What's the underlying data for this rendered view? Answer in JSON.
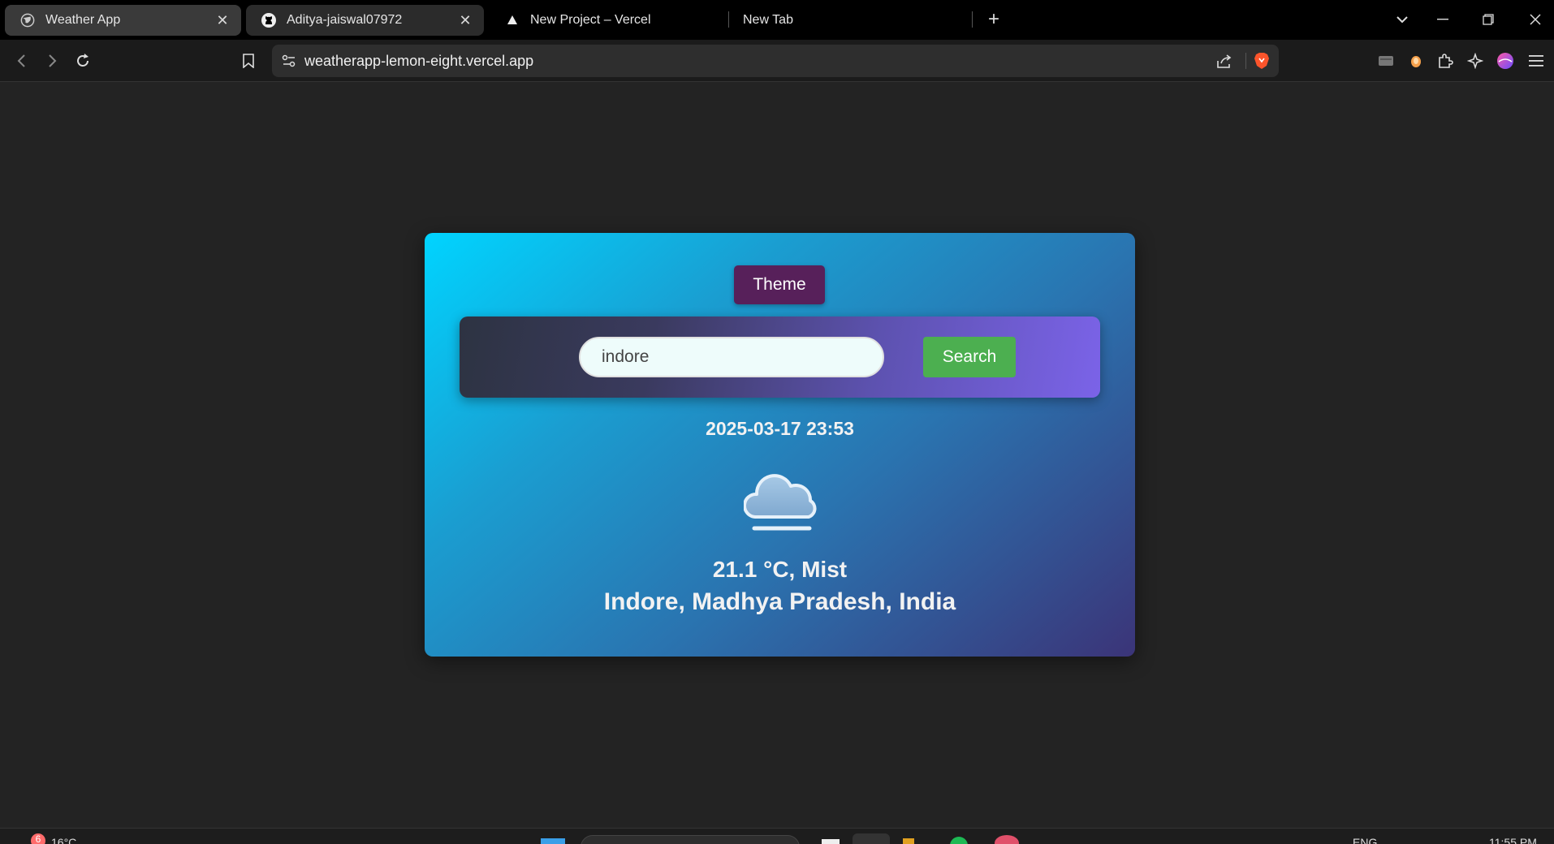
{
  "browser": {
    "tabs": [
      {
        "title": "Weather App",
        "icon": "globe-icon",
        "active": true
      },
      {
        "title": "Aditya-jaiswal07972",
        "icon": "github-icon",
        "active": false
      },
      {
        "title": "New Project – Vercel",
        "icon": "vercel-triangle-icon",
        "active": false
      },
      {
        "title": "New Tab",
        "icon": "none",
        "active": false
      }
    ],
    "address": "weatherapp-lemon-eight.vercel.app"
  },
  "app": {
    "theme_label": "Theme",
    "search": {
      "value": "indore",
      "placeholder": "",
      "button_label": "Search"
    },
    "datetime": "2025-03-17 23:53",
    "condition_icon": "mist-cloud-icon",
    "temperature_line": "21.1 °C, Mist",
    "location_line": "Indore, Madhya Pradesh, India"
  },
  "taskbar": {
    "weather_badge": "6",
    "weather_temp": "16°C",
    "language": "ENG",
    "time": "11:55 PM"
  },
  "colors": {
    "theme_button": "#57205a",
    "search_button": "#4caf50",
    "card_gradient_start": "#00d4ff",
    "card_gradient_end": "#3b3478"
  }
}
